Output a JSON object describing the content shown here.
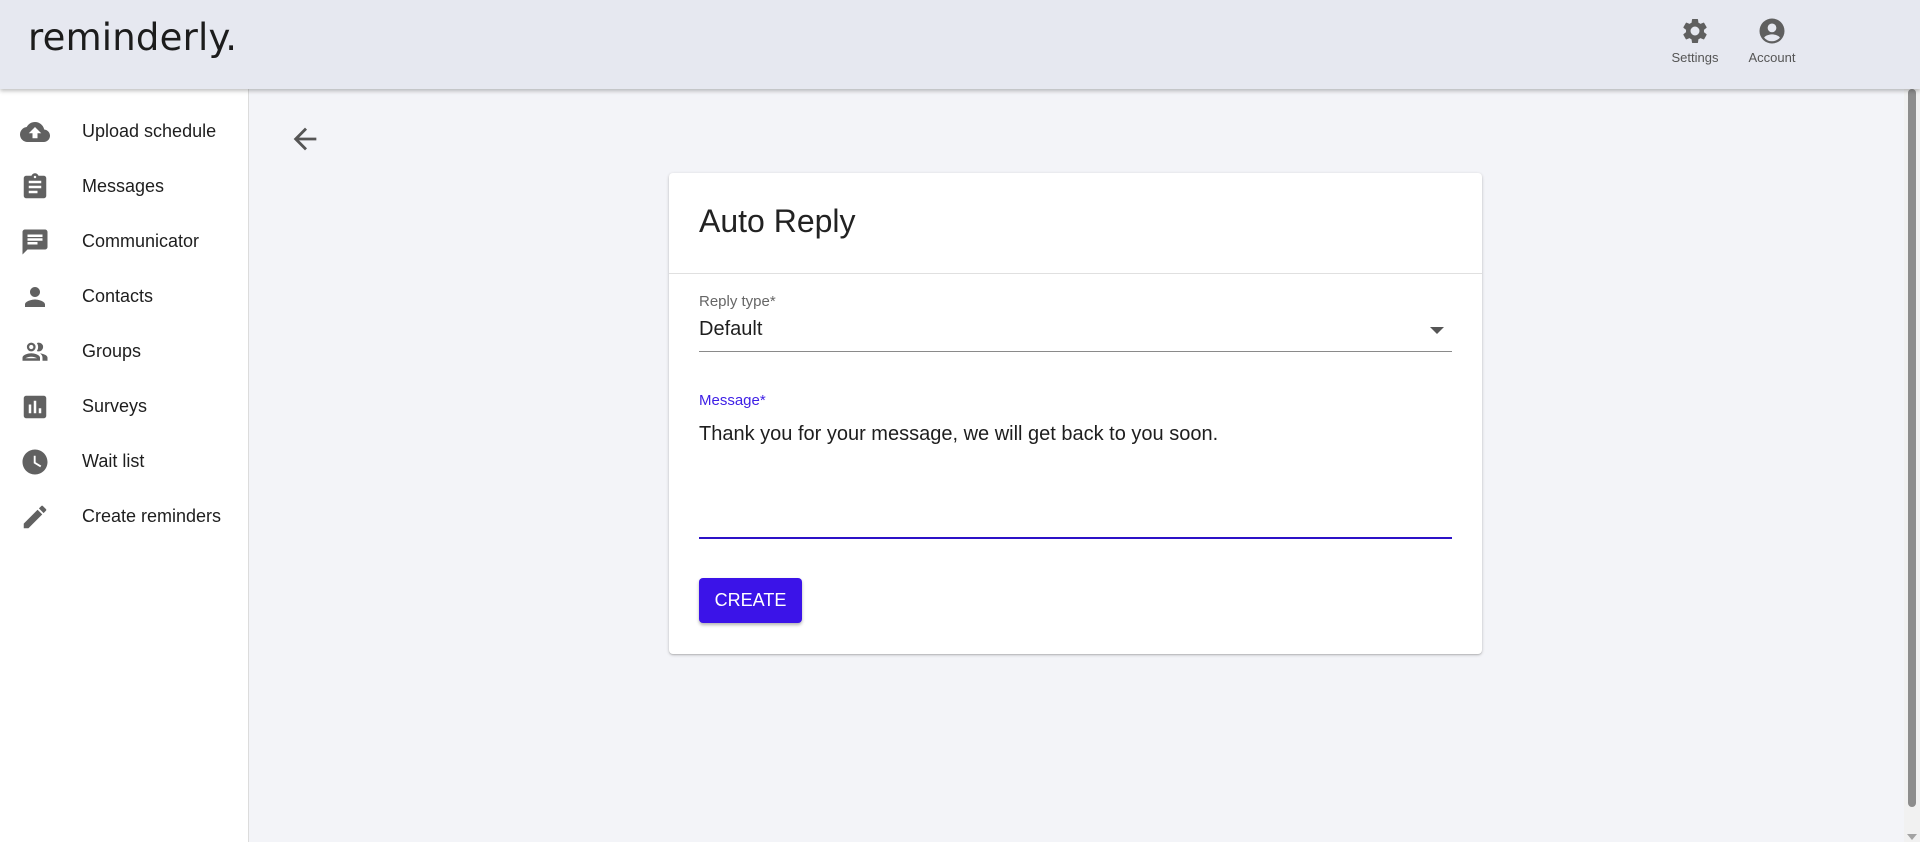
{
  "app": {
    "logo": "reminderly."
  },
  "header": {
    "actions": [
      {
        "label": "Settings",
        "icon": "gear-icon"
      },
      {
        "label": "Account",
        "icon": "account-circle-icon"
      }
    ]
  },
  "sidebar": {
    "items": [
      {
        "label": "Upload schedule",
        "icon": "cloud-upload-icon"
      },
      {
        "label": "Messages",
        "icon": "clipboard-icon"
      },
      {
        "label": "Communicator",
        "icon": "chat-icon"
      },
      {
        "label": "Contacts",
        "icon": "person-icon"
      },
      {
        "label": "Groups",
        "icon": "group-icon"
      },
      {
        "label": "Surveys",
        "icon": "bar-chart-icon"
      },
      {
        "label": "Wait list",
        "icon": "clock-icon"
      },
      {
        "label": "Create reminders",
        "icon": "pencil-icon"
      }
    ]
  },
  "main": {
    "back_icon": "arrow-left-icon",
    "card": {
      "title": "Auto Reply",
      "reply_type": {
        "label": "Reply type*",
        "value": "Default"
      },
      "message": {
        "label": "Message*",
        "value": "Thank you for your message, we will get back to you soon."
      },
      "create_label": "CREATE"
    }
  },
  "colors": {
    "primary": "#3b13e8",
    "header_bg": "#e6e8f0",
    "page_bg": "#f3f4f8"
  }
}
